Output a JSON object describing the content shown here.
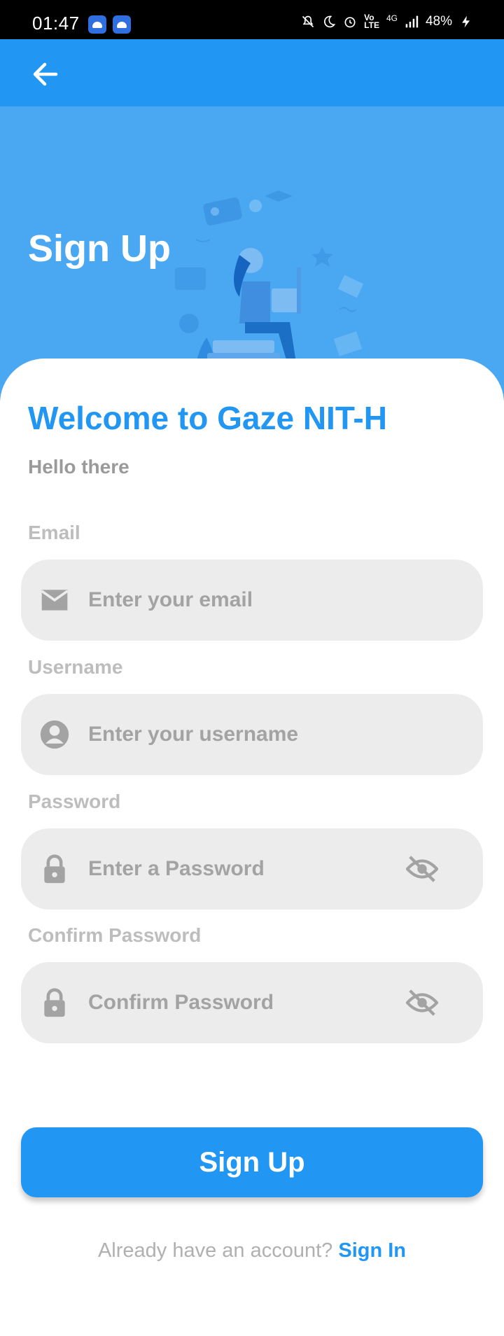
{
  "status_bar": {
    "time": "01:47",
    "battery": "48%",
    "network": "4G"
  },
  "colors": {
    "primary": "#2196f3",
    "hero_bg": "#4aa8f2",
    "field_bg": "#ececec",
    "label_gray": "#bdbdbd"
  },
  "header": {
    "title": "Sign Up"
  },
  "form": {
    "welcome": "Welcome to Gaze NIT-H",
    "subtitle": "Hello there",
    "email": {
      "label": "Email",
      "placeholder": "Enter your email",
      "icon": "email-icon"
    },
    "username": {
      "label": "Username",
      "placeholder": "Enter your username",
      "icon": "account-circle-icon"
    },
    "password": {
      "label": "Password",
      "placeholder": "Enter a Password",
      "icon": "lock-icon",
      "toggle_icon": "visibility-off-icon"
    },
    "confirm_password": {
      "label": "Confirm Password",
      "placeholder": "Confirm Password",
      "icon": "lock-icon",
      "toggle_icon": "visibility-off-icon"
    },
    "submit_label": "Sign Up"
  },
  "footer": {
    "question": "Already have an account? ",
    "link_label": "Sign In"
  }
}
